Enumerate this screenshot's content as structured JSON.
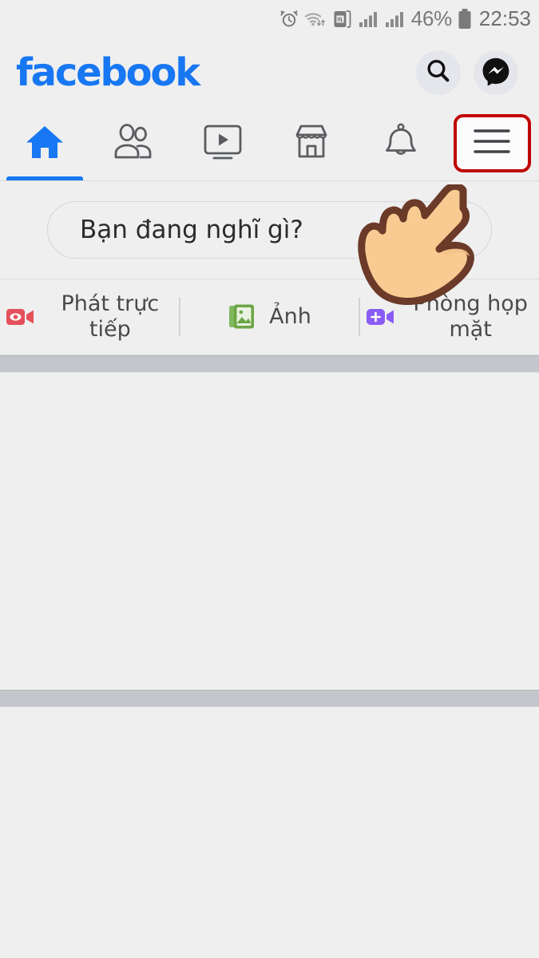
{
  "status_bar": {
    "icons": [
      "alarm-clock-icon",
      "wifi-icon",
      "hd-sim-icon",
      "signal-bars-1-icon",
      "signal-bars-2-icon"
    ],
    "battery_percent": "46%",
    "battery_icon": "battery-icon",
    "time": "22:53"
  },
  "header": {
    "logo": "facebook",
    "logo_color": "#1877f2",
    "search_icon": "search-icon",
    "messenger_icon": "messenger-icon"
  },
  "nav_tabs": [
    {
      "name": "home",
      "icon": "home-icon",
      "active": true
    },
    {
      "name": "friends",
      "icon": "friends-icon",
      "active": false
    },
    {
      "name": "watch",
      "icon": "video-play-icon",
      "active": false
    },
    {
      "name": "marketplace",
      "icon": "storefront-icon",
      "active": false
    },
    {
      "name": "notifications",
      "icon": "bell-icon",
      "active": false
    },
    {
      "name": "menu",
      "icon": "hamburger-menu-icon",
      "active": false,
      "highlighted": true
    }
  ],
  "highlight": {
    "border_color": "#c00000",
    "fill_color": "#fcfcfc"
  },
  "composer": {
    "placeholder": "Bạn đang nghĩ gì?"
  },
  "actions": [
    {
      "name": "live-video",
      "label": "Phát trực tiếp",
      "icon": "live-video-icon",
      "color": "#e4505a"
    },
    {
      "name": "photo",
      "label": "Ảnh",
      "icon": "photo-gallery-icon",
      "color": "#6ba644"
    },
    {
      "name": "room",
      "label": "Phòng họp mặt",
      "icon": "video-room-icon",
      "color": "#8a5cf5"
    }
  ],
  "colors": {
    "page_background": "#efefef",
    "divider_band": "#c3c6cb",
    "accent_blue": "#1877f2"
  },
  "cursor": {
    "name": "pointing-hand-cursor",
    "skin": "#f6c288",
    "outline": "#6b3a28"
  }
}
